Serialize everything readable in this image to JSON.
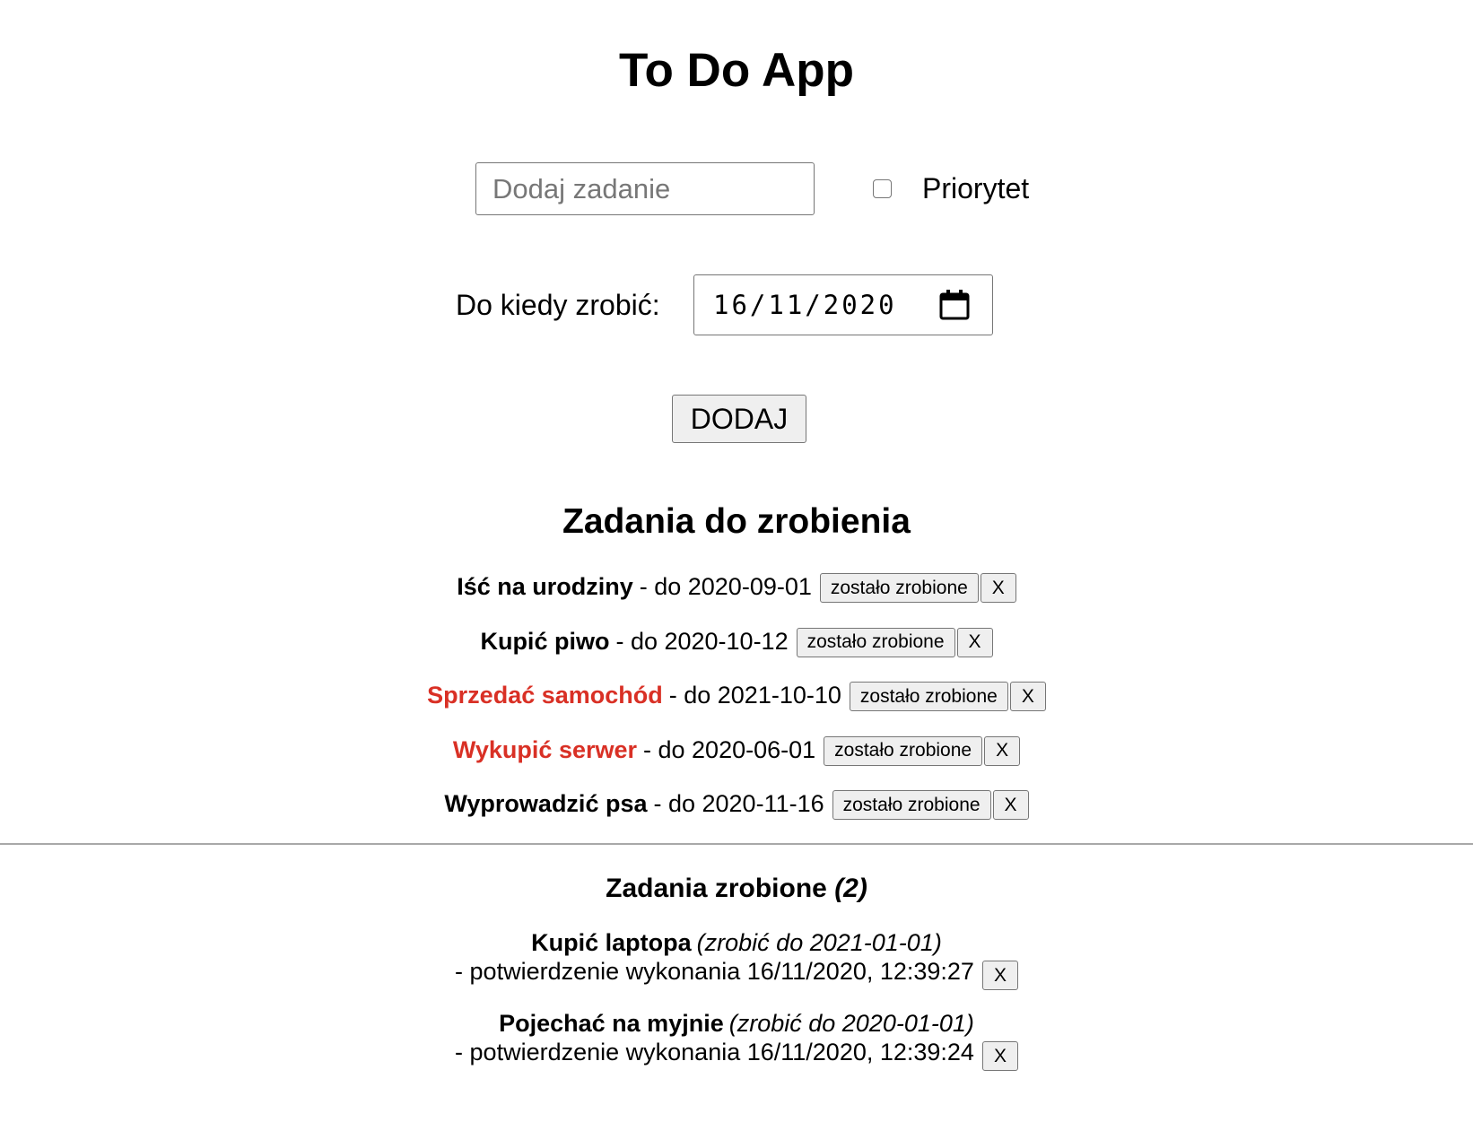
{
  "header": {
    "title": "To Do App"
  },
  "form": {
    "task_placeholder": "Dodaj zadanie",
    "task_value": "",
    "priority_label": "Priorytet",
    "priority_checked": false,
    "date_label": "Do kiedy zrobić:",
    "date_value": "16/11/2020",
    "add_label": "DODAJ"
  },
  "todo": {
    "title": "Zadania do zrobienia",
    "done_button_label": "zostało zrobione",
    "remove_button_label": "X",
    "priority_color": "#d93025",
    "items": [
      {
        "name": "Iść na urodziny",
        "due": "- do 2020-09-01",
        "priority": false
      },
      {
        "name": "Kupić piwo",
        "due": "- do 2020-10-12",
        "priority": false
      },
      {
        "name": "Sprzedać samochód",
        "due": "- do 2021-10-10",
        "priority": true
      },
      {
        "name": "Wykupić serwer",
        "due": "- do 2020-06-01",
        "priority": true
      },
      {
        "name": "Wyprowadzić psa",
        "due": "- do 2020-11-16",
        "priority": false
      }
    ]
  },
  "done": {
    "title": "Zadania zrobione",
    "count_label": "(2)",
    "remove_button_label": "X",
    "items": [
      {
        "name": "Kupić laptopa",
        "due": "(zrobić do 2021-01-01)",
        "confirmation": "- potwierdzenie wykonania 16/11/2020, 12:39:27"
      },
      {
        "name": "Pojechać na myjnie",
        "due": "(zrobić do 2020-01-01)",
        "confirmation": "- potwierdzenie wykonania 16/11/2020, 12:39:24"
      }
    ]
  }
}
